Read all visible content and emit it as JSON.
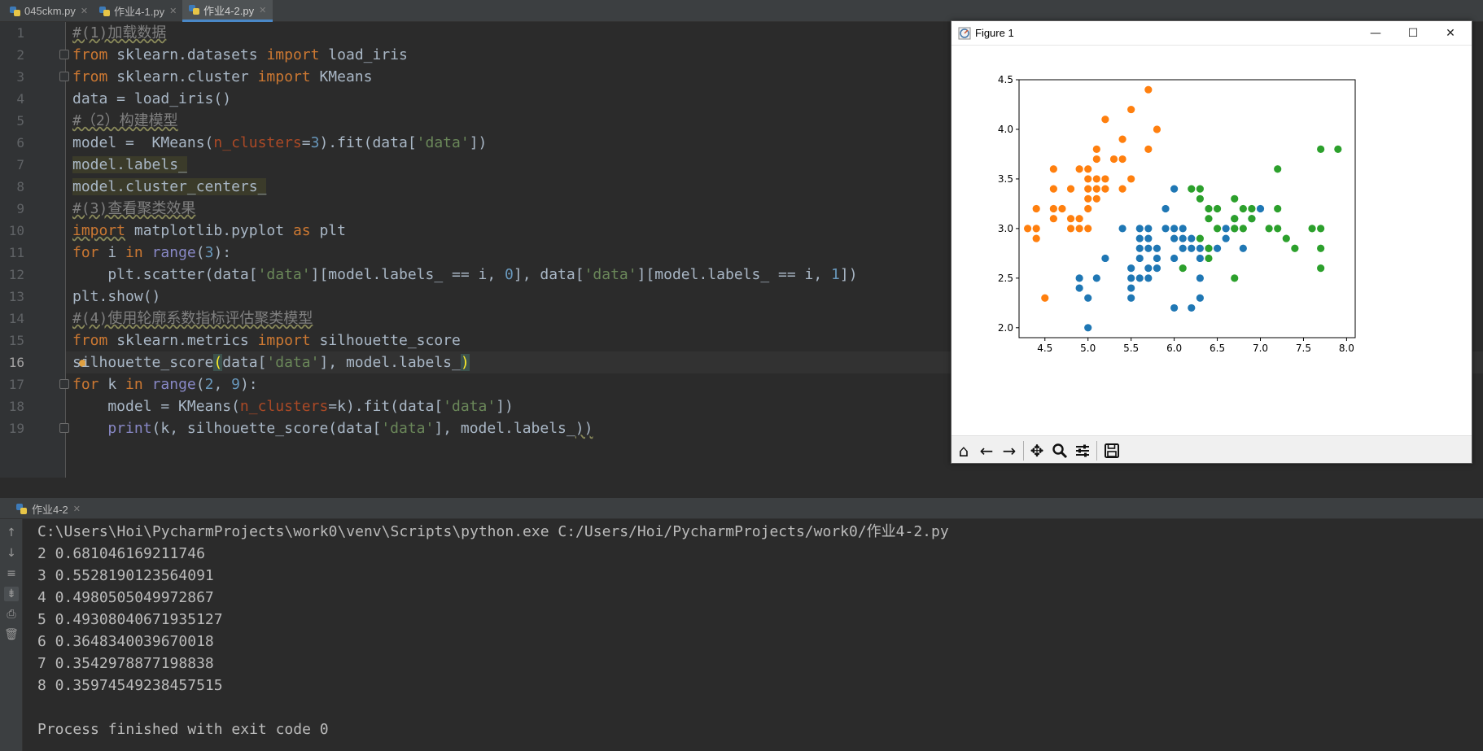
{
  "tabs": [
    {
      "label": "045ckm.py"
    },
    {
      "label": "作业4-1.py"
    },
    {
      "label": "作业4-2.py"
    }
  ],
  "editor": {
    "line_numbers": [
      "1",
      "2",
      "3",
      "4",
      "5",
      "6",
      "7",
      "8",
      "9",
      "10",
      "11",
      "12",
      "13",
      "14",
      "15",
      "16",
      "17",
      "18",
      "19"
    ],
    "current_line": "16"
  },
  "figure": {
    "title": "Figure 1",
    "colors": {
      "cluster0": "#1f77b4",
      "cluster1": "#ff7f0e",
      "cluster2": "#2ca02c"
    }
  },
  "run": {
    "tab_label": "作业4-2",
    "command": "C:\\Users\\Hoi\\PycharmProjects\\work0\\venv\\Scripts\\python.exe C:/Users/Hoi/PycharmProjects/work0/作业4-2.py",
    "output": [
      "2 0.681046169211746",
      "3 0.5528190123564091",
      "4 0.4980505049972867",
      "5 0.49308040671935127",
      "6 0.3648340039670018",
      "7 0.3542978877198838",
      "8 0.35974549238457515"
    ],
    "exit_message": "Process finished with exit code 0"
  },
  "chart_data": {
    "type": "scatter",
    "title": "",
    "xlabel": "",
    "ylabel": "",
    "xlim": [
      4.2,
      8.1
    ],
    "ylim": [
      1.9,
      4.5
    ],
    "xticks": [
      "4.5",
      "5.0",
      "5.5",
      "6.0",
      "6.5",
      "7.0",
      "7.5",
      "8.0"
    ],
    "yticks": [
      "2.0",
      "2.5",
      "3.0",
      "3.5",
      "4.0",
      "4.5"
    ],
    "series": [
      {
        "color": "#1f77b4",
        "points": [
          [
            4.9,
            2.5
          ],
          [
            4.9,
            2.4
          ],
          [
            5.0,
            2.3
          ],
          [
            5.0,
            2.0
          ],
          [
            5.1,
            2.5
          ],
          [
            5.2,
            2.7
          ],
          [
            5.4,
            3.0
          ],
          [
            5.5,
            2.6
          ],
          [
            5.5,
            2.5
          ],
          [
            5.5,
            2.4
          ],
          [
            5.5,
            2.3
          ],
          [
            5.6,
            3.0
          ],
          [
            5.6,
            2.9
          ],
          [
            5.6,
            2.8
          ],
          [
            5.6,
            2.7
          ],
          [
            5.6,
            2.5
          ],
          [
            5.7,
            3.0
          ],
          [
            5.7,
            2.9
          ],
          [
            5.7,
            2.8
          ],
          [
            5.7,
            2.6
          ],
          [
            5.7,
            2.5
          ],
          [
            5.8,
            2.8
          ],
          [
            5.8,
            2.7
          ],
          [
            5.8,
            2.6
          ],
          [
            5.9,
            3.2
          ],
          [
            5.9,
            3.0
          ],
          [
            6.0,
            3.4
          ],
          [
            6.0,
            3.0
          ],
          [
            6.0,
            2.9
          ],
          [
            6.0,
            2.7
          ],
          [
            6.0,
            2.2
          ],
          [
            6.1,
            3.0
          ],
          [
            6.1,
            2.9
          ],
          [
            6.1,
            2.8
          ],
          [
            6.2,
            2.9
          ],
          [
            6.2,
            2.8
          ],
          [
            6.2,
            2.2
          ],
          [
            6.3,
            2.8
          ],
          [
            6.3,
            2.7
          ],
          [
            6.3,
            2.5
          ],
          [
            6.3,
            2.3
          ],
          [
            6.4,
            2.8
          ],
          [
            6.5,
            2.8
          ],
          [
            6.6,
            3.0
          ],
          [
            6.6,
            2.9
          ],
          [
            6.7,
            3.1
          ],
          [
            6.7,
            3.0
          ],
          [
            6.8,
            2.8
          ],
          [
            6.9,
            3.1
          ],
          [
            7.0,
            3.2
          ]
        ]
      },
      {
        "color": "#ff7f0e",
        "points": [
          [
            4.3,
            3.0
          ],
          [
            4.4,
            3.2
          ],
          [
            4.4,
            3.0
          ],
          [
            4.4,
            2.9
          ],
          [
            4.5,
            2.3
          ],
          [
            4.6,
            3.6
          ],
          [
            4.6,
            3.4
          ],
          [
            4.6,
            3.2
          ],
          [
            4.6,
            3.1
          ],
          [
            4.7,
            3.2
          ],
          [
            4.8,
            3.4
          ],
          [
            4.8,
            3.1
          ],
          [
            4.8,
            3.0
          ],
          [
            4.9,
            3.6
          ],
          [
            4.9,
            3.1
          ],
          [
            4.9,
            3.0
          ],
          [
            5.0,
            3.6
          ],
          [
            5.0,
            3.5
          ],
          [
            5.0,
            3.4
          ],
          [
            5.0,
            3.3
          ],
          [
            5.0,
            3.2
          ],
          [
            5.0,
            3.0
          ],
          [
            5.1,
            3.8
          ],
          [
            5.1,
            3.7
          ],
          [
            5.1,
            3.5
          ],
          [
            5.1,
            3.4
          ],
          [
            5.1,
            3.3
          ],
          [
            5.2,
            4.1
          ],
          [
            5.2,
            3.5
          ],
          [
            5.2,
            3.4
          ],
          [
            5.3,
            3.7
          ],
          [
            5.4,
            3.9
          ],
          [
            5.4,
            3.7
          ],
          [
            5.4,
            3.4
          ],
          [
            5.5,
            4.2
          ],
          [
            5.5,
            3.5
          ],
          [
            5.7,
            4.4
          ],
          [
            5.7,
            3.8
          ],
          [
            5.8,
            4.0
          ]
        ]
      },
      {
        "color": "#2ca02c",
        "points": [
          [
            6.1,
            2.6
          ],
          [
            6.2,
            3.4
          ],
          [
            6.3,
            3.4
          ],
          [
            6.3,
            3.3
          ],
          [
            6.3,
            2.9
          ],
          [
            6.4,
            3.2
          ],
          [
            6.4,
            3.1
          ],
          [
            6.4,
            2.8
          ],
          [
            6.4,
            2.7
          ],
          [
            6.5,
            3.2
          ],
          [
            6.5,
            3.0
          ],
          [
            6.7,
            3.3
          ],
          [
            6.7,
            3.1
          ],
          [
            6.7,
            3.0
          ],
          [
            6.7,
            2.5
          ],
          [
            6.8,
            3.2
          ],
          [
            6.8,
            3.0
          ],
          [
            6.9,
            3.2
          ],
          [
            6.9,
            3.1
          ],
          [
            7.1,
            3.0
          ],
          [
            7.2,
            3.6
          ],
          [
            7.2,
            3.2
          ],
          [
            7.2,
            3.0
          ],
          [
            7.3,
            2.9
          ],
          [
            7.4,
            2.8
          ],
          [
            7.6,
            3.0
          ],
          [
            7.7,
            3.8
          ],
          [
            7.7,
            3.0
          ],
          [
            7.7,
            2.8
          ],
          [
            7.7,
            2.6
          ],
          [
            7.9,
            3.8
          ]
        ]
      }
    ]
  }
}
